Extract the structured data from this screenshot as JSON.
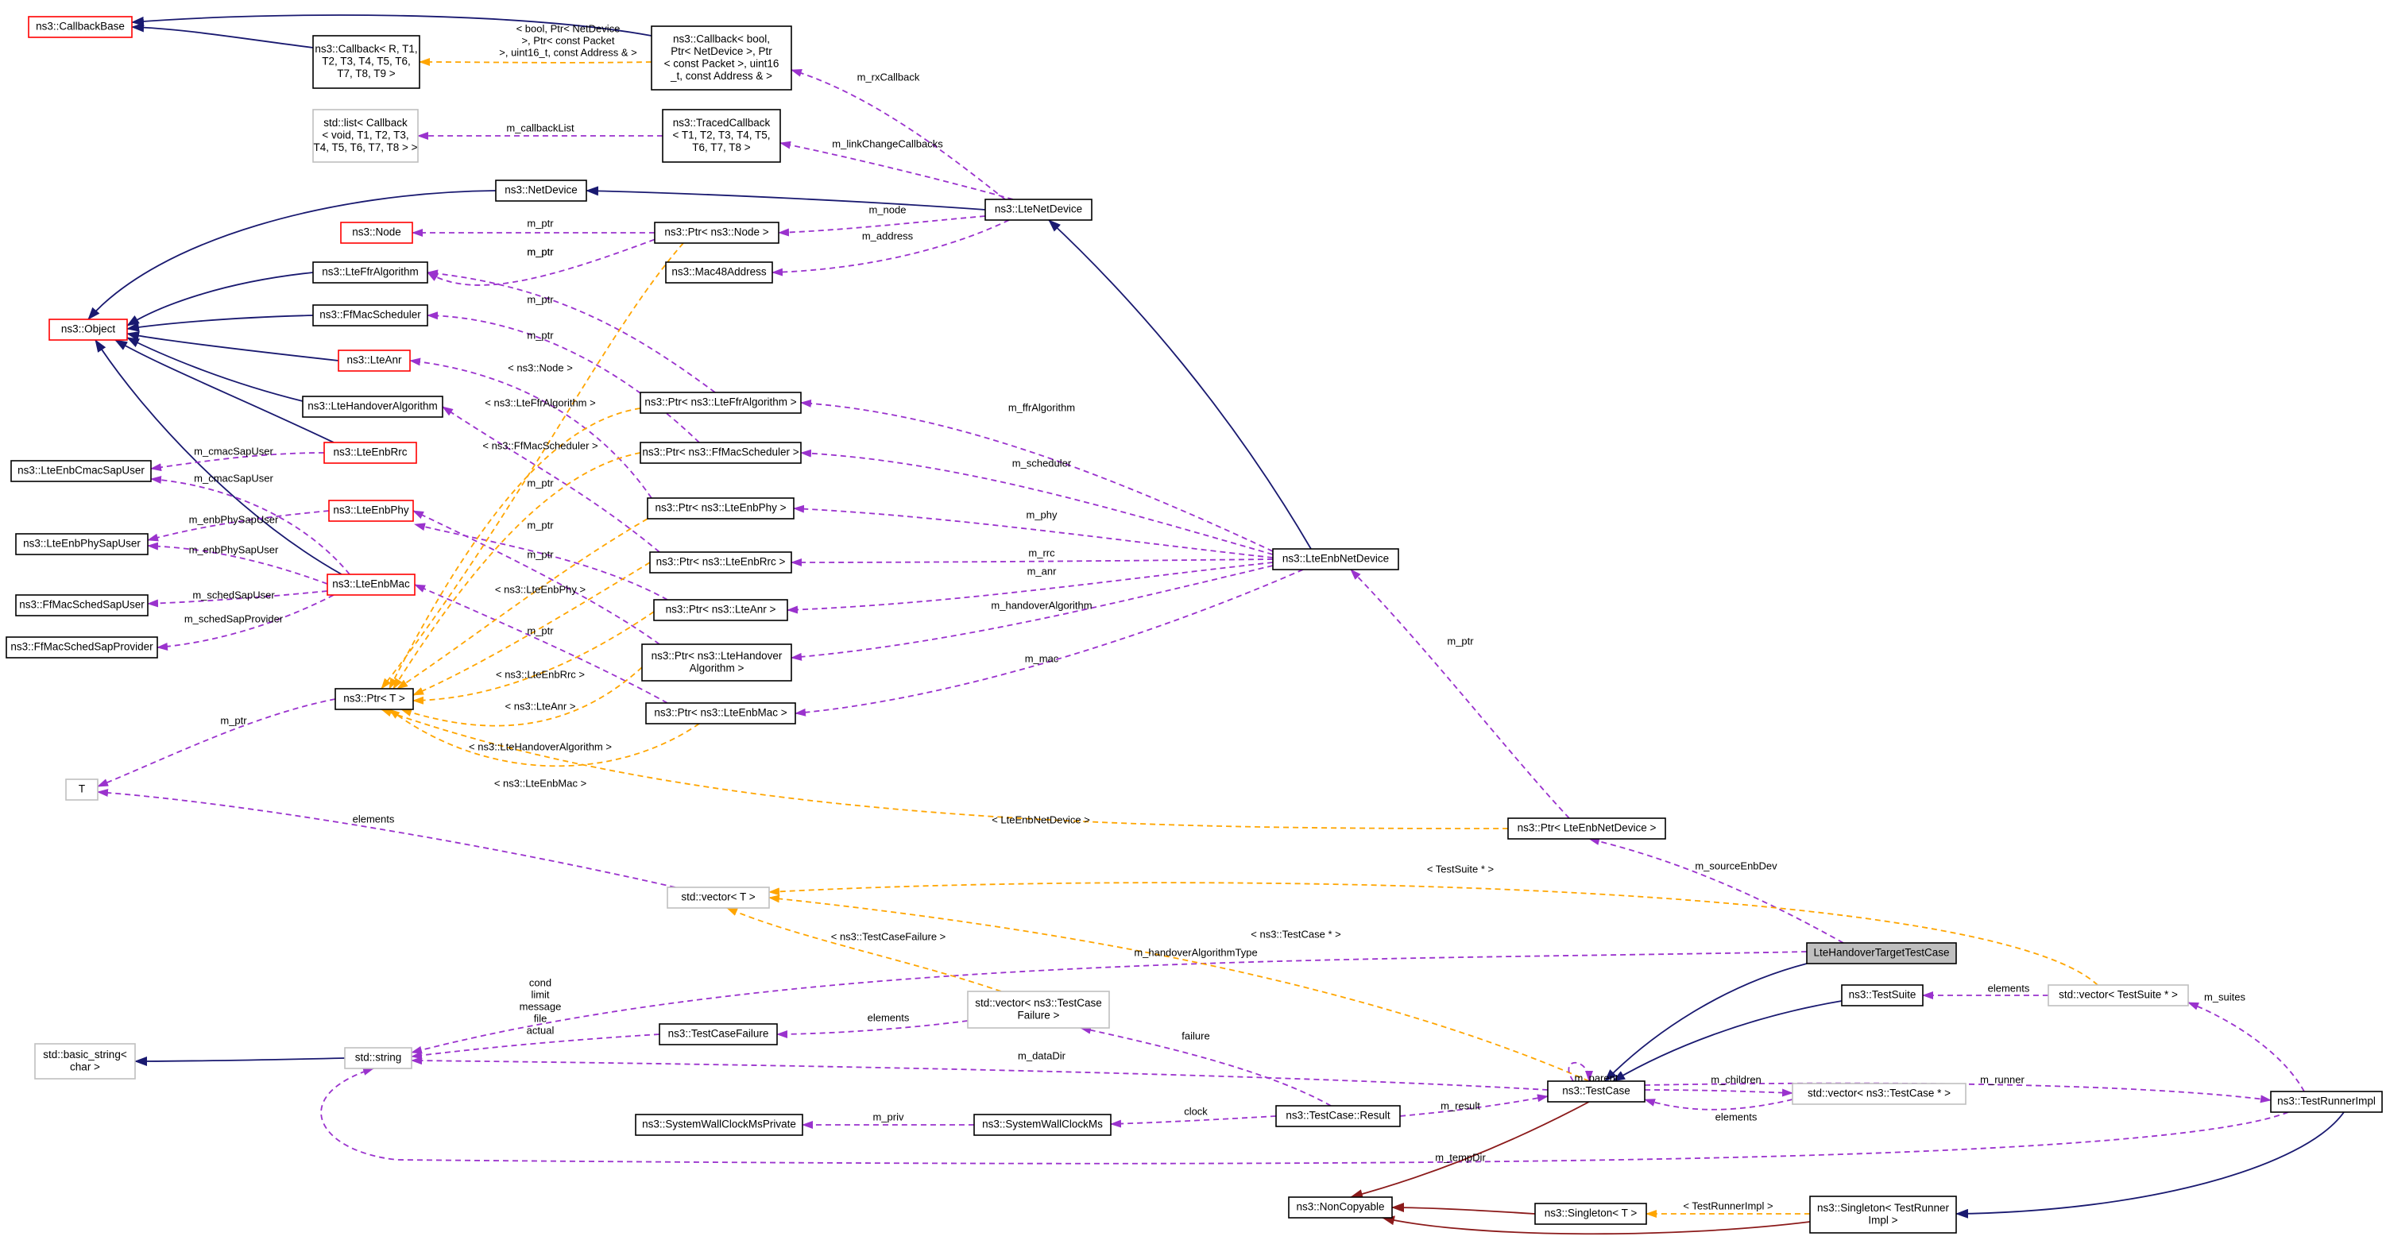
{
  "colors": {
    "usage_edge": "#9a32cd",
    "template_edge": "#ffa500",
    "inheritance_edge": "#191970",
    "private_inheritance_edge": "#8b1a1a",
    "focus_fill": "#bfbfbf",
    "undocumented_border": "#ff0000",
    "external_border": "#bfbfbf"
  },
  "nodes": {
    "callbackbase": {
      "lines": [
        "ns3::CallbackBase"
      ],
      "style": "red"
    },
    "callback_generic": {
      "lines": [
        "ns3::Callback< R, T1,",
        "T2, T3, T4, T5, T6,",
        "T7, T8, T9 >"
      ],
      "style": "normal"
    },
    "callback_rx": {
      "lines": [
        "ns3::Callback< bool,",
        "Ptr< NetDevice >, Ptr",
        "< const Packet >, uint16",
        "_t, const Address & >"
      ],
      "style": "normal"
    },
    "stdlist_callback": {
      "lines": [
        "std::list< Callback",
        "< void, T1, T2, T3,",
        "T4, T5, T6, T7, T8 > >"
      ],
      "style": "grey"
    },
    "tracedcallback": {
      "lines": [
        "ns3::TracedCallback",
        "< T1, T2, T3, T4, T5,",
        "T6, T7, T8 >"
      ],
      "style": "normal"
    },
    "netdevice": {
      "lines": [
        "ns3::NetDevice"
      ],
      "style": "normal"
    },
    "ltenetdevice": {
      "lines": [
        "ns3::LteNetDevice"
      ],
      "style": "normal"
    },
    "node": {
      "lines": [
        "ns3::Node"
      ],
      "style": "red"
    },
    "ptr_node": {
      "lines": [
        "ns3::Ptr< ns3::Node >"
      ],
      "style": "normal"
    },
    "mac48": {
      "lines": [
        "ns3::Mac48Address"
      ],
      "style": "normal"
    },
    "object": {
      "lines": [
        "ns3::Object"
      ],
      "style": "red"
    },
    "lteffr": {
      "lines": [
        "ns3::LteFfrAlgorithm"
      ],
      "style": "normal"
    },
    "ffmacsched": {
      "lines": [
        "ns3::FfMacScheduler"
      ],
      "style": "normal"
    },
    "lteanr": {
      "lines": [
        "ns3::LteAnr"
      ],
      "style": "red"
    },
    "ltehandover": {
      "lines": [
        "ns3::LteHandoverAlgorithm"
      ],
      "style": "normal"
    },
    "lteenbrrc": {
      "lines": [
        "ns3::LteEnbRrc"
      ],
      "style": "red"
    },
    "lteenbphy": {
      "lines": [
        "ns3::LteEnbPhy"
      ],
      "style": "red"
    },
    "lteenbmac": {
      "lines": [
        "ns3::LteEnbMac"
      ],
      "style": "red"
    },
    "cmacsapuser": {
      "lines": [
        "ns3::LteEnbCmacSapUser"
      ],
      "style": "normal"
    },
    "physapuser": {
      "lines": [
        "ns3::LteEnbPhySapUser"
      ],
      "style": "normal"
    },
    "ffschedsapuser": {
      "lines": [
        "ns3::FfMacSchedSapUser"
      ],
      "style": "normal"
    },
    "ffschedsapprov": {
      "lines": [
        "ns3::FfMacSchedSapProvider"
      ],
      "style": "normal"
    },
    "ptr_ffr": {
      "lines": [
        "ns3::Ptr< ns3::LteFfrAlgorithm >"
      ],
      "style": "normal"
    },
    "ptr_sched": {
      "lines": [
        "ns3::Ptr< ns3::FfMacScheduler >"
      ],
      "style": "normal"
    },
    "ptr_phy": {
      "lines": [
        "ns3::Ptr< ns3::LteEnbPhy >"
      ],
      "style": "normal"
    },
    "ptr_rrc": {
      "lines": [
        "ns3::Ptr< ns3::LteEnbRrc >"
      ],
      "style": "normal"
    },
    "ptr_anr": {
      "lines": [
        "ns3::Ptr< ns3::LteAnr >"
      ],
      "style": "normal"
    },
    "ptr_handover": {
      "lines": [
        "ns3::Ptr< ns3::LteHandover",
        "Algorithm >"
      ],
      "style": "normal"
    },
    "ptr_mac": {
      "lines": [
        "ns3::Ptr< ns3::LteEnbMac >"
      ],
      "style": "normal"
    },
    "lteenbnetdevice": {
      "lines": [
        "ns3::LteEnbNetDevice"
      ],
      "style": "normal"
    },
    "ptr_t": {
      "lines": [
        "ns3::Ptr< T >"
      ],
      "style": "normal"
    },
    "t": {
      "lines": [
        "T"
      ],
      "style": "grey"
    },
    "ptr_lteenbnetdevice": {
      "lines": [
        "ns3::Ptr< LteEnbNetDevice >"
      ],
      "style": "normal"
    },
    "stdvector_t": {
      "lines": [
        "std::vector< T >"
      ],
      "style": "grey"
    },
    "target": {
      "lines": [
        "LteHandoverTargetTestCase"
      ],
      "style": "focus"
    },
    "testsuite": {
      "lines": [
        "ns3::TestSuite"
      ],
      "style": "normal"
    },
    "stdvector_testsuite": {
      "lines": [
        "std::vector< TestSuite * >"
      ],
      "style": "grey"
    },
    "stdvector_failure": {
      "lines": [
        "std::vector< ns3::TestCase",
        "Failure >"
      ],
      "style": "grey"
    },
    "basic_string": {
      "lines": [
        "std::basic_string<",
        "char >"
      ],
      "style": "grey"
    },
    "stdstring": {
      "lines": [
        "std::string"
      ],
      "style": "grey"
    },
    "testcasefailure": {
      "lines": [
        "ns3::TestCaseFailure"
      ],
      "style": "normal"
    },
    "testcase": {
      "lines": [
        "ns3::TestCase"
      ],
      "style": "normal"
    },
    "stdvector_testcase": {
      "lines": [
        "std::vector< ns3::TestCase * >"
      ],
      "style": "grey"
    },
    "testrunnerimpl": {
      "lines": [
        "ns3::TestRunnerImpl"
      ],
      "style": "normal"
    },
    "swcmprivate": {
      "lines": [
        "ns3::SystemWallClockMsPrivate"
      ],
      "style": "normal"
    },
    "swcm": {
      "lines": [
        "ns3::SystemWallClockMs"
      ],
      "style": "normal"
    },
    "testcase_result": {
      "lines": [
        "ns3::TestCase::Result"
      ],
      "style": "normal"
    },
    "noncopyable": {
      "lines": [
        "ns3::NonCopyable"
      ],
      "style": "normal"
    },
    "singleton_t": {
      "lines": [
        "ns3::Singleton< T >"
      ],
      "style": "normal"
    },
    "singleton_runner": {
      "lines": [
        "ns3::Singleton< TestRunner",
        "Impl >"
      ],
      "style": "normal"
    }
  },
  "edge_labels": {
    "callback_tpl": [
      "< bool, Ptr< NetDevice",
      ">, Ptr< const Packet",
      ">, uint16_t, const Address & >"
    ],
    "m_rxCallback": "m_rxCallback",
    "m_callbackList": "m_callbackList",
    "m_linkChangeCallbacks": "m_linkChangeCallbacks",
    "m_node": "m_node",
    "m_address": "m_address",
    "m_ptr": "m_ptr",
    "node_tpl": "< ns3::Node >",
    "ffr_tpl": "< ns3::LteFfrAlgorithm >",
    "sched_tpl": "< ns3::FfMacScheduler >",
    "phy_tpl": "< ns3::LteEnbPhy >",
    "rrc_tpl": "< ns3::LteEnbRrc >",
    "anr_tpl": "< ns3::LteAnr >",
    "handover_tpl": "< ns3::LteHandoverAlgorithm >",
    "mac_tpl": "< ns3::LteEnbMac >",
    "m_cmacSapUser": "m_cmacSapUser",
    "m_enbPhySapUser": "m_enbPhySapUser",
    "m_schedSapUser": "m_schedSapUser",
    "m_schedSapProvider": "m_schedSapProvider",
    "m_ffrAlgorithm": "m_ffrAlgorithm",
    "m_scheduler": "m_scheduler",
    "m_phy": "m_phy",
    "m_rrc": "m_rrc",
    "m_anr": "m_anr",
    "m_handoverAlgorithm": "m_handoverAlgorithm",
    "m_mac": "m_mac",
    "elements": "elements",
    "enbdev_tpl": "< LteEnbNetDevice >",
    "m_sourceEnbDev": "m_sourceEnbDev",
    "testsuite_tpl": "< TestSuite * >",
    "failure_tpl": "< ns3::TestCaseFailure >",
    "m_handoverAlgorithmType": "m_handoverAlgorithmType",
    "testcase_tpl": "< ns3::TestCase * >",
    "string_fields": [
      "cond",
      "limit",
      "message",
      "file",
      "actual"
    ],
    "m_suites": "m_suites",
    "failure": "failure",
    "m_dataDir": "m_dataDir",
    "m_name": "m_name",
    "m_parent": "m_parent",
    "m_children": "m_children",
    "m_runner": "m_runner",
    "m_result": "m_result",
    "m_priv": "m_priv",
    "clock": "clock",
    "m_tempDir": "m_tempDir",
    "runner_tpl": "< TestRunnerImpl >"
  }
}
